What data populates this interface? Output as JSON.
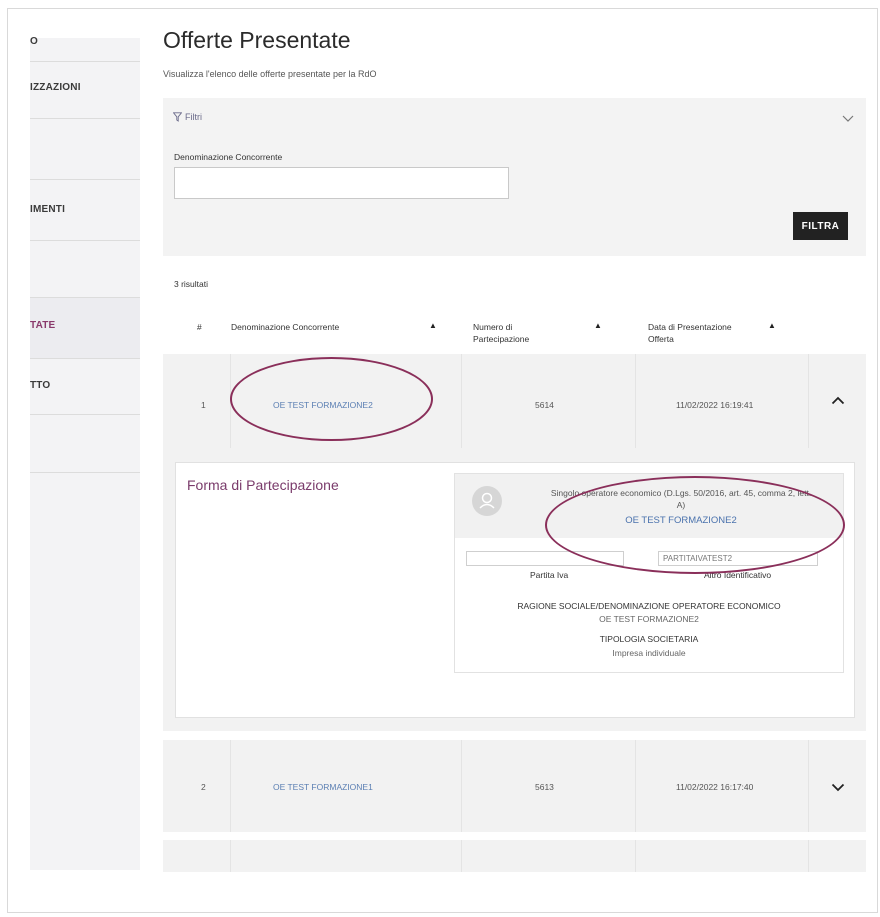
{
  "sidebar": {
    "items": [
      {
        "label": "O"
      },
      {
        "label": "IZZAZIONI"
      },
      {
        "label": "IMENTI"
      },
      {
        "label": "TATE"
      },
      {
        "label": "TTO"
      }
    ]
  },
  "page": {
    "title": "Offerte Presentate",
    "subtitle": "Visualizza l'elenco delle offerte presentate per la RdO"
  },
  "filters": {
    "toggle_label": "Filtri",
    "field_label": "Denominazione Concorrente",
    "field_value": "",
    "button_label": "FILTRA"
  },
  "results": {
    "count_text": "3 risultati",
    "headers": {
      "index": "#",
      "name": "Denominazione Concorrente",
      "number_line1": "Numero di",
      "number_line2": "Partecipazione",
      "date_line1": "Data di Presentazione",
      "date_line2": "Offerta"
    },
    "rows": [
      {
        "index": "1",
        "name": "OE TEST FORMAZIONE2",
        "number": "5614",
        "date": "11/02/2022 16:19:41"
      },
      {
        "index": "2",
        "name": "OE TEST FORMAZIONE1",
        "number": "5613",
        "date": "11/02/2022 16:17:40"
      }
    ]
  },
  "detail": {
    "title": "Forma di Partecipazione",
    "description_line1": "Singolo operatore economico (D.Lgs. 50/2016, art. 45, comma 2, lett.",
    "description_line2": "A)",
    "operator_name": "OE TEST FORMAZIONE2",
    "partita_iva_value": "",
    "partita_iva_label": "Partita Iva",
    "altro_id_value": "PARTITAIVATEST2",
    "altro_id_label": "Altro Identificativo",
    "ragione_sociale_label": "RAGIONE SOCIALE/DENOMINAZIONE OPERATORE ECONOMICO",
    "ragione_sociale_value": "OE TEST FORMAZIONE2",
    "tipologia_label": "TIPOLOGIA SOCIETARIA",
    "tipologia_value": "Impresa individuale"
  },
  "colors": {
    "accent": "#7a3b6b",
    "link": "#5b7fb3",
    "annotation": "#8a2f5a"
  }
}
